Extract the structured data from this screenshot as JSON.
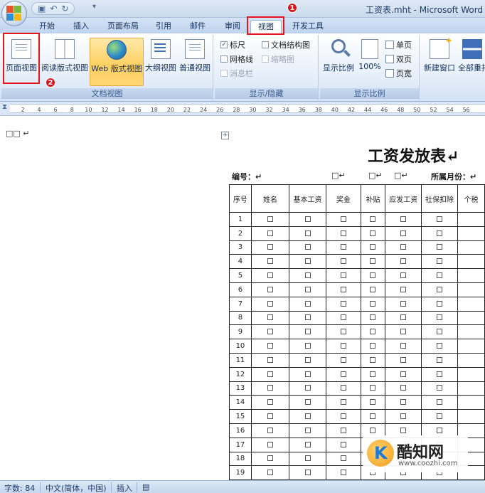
{
  "window": {
    "title": "工资表.mht - Microsoft Word"
  },
  "tabs": [
    "开始",
    "插入",
    "页面布局",
    "引用",
    "邮件",
    "审阅",
    "视图",
    "开发工具"
  ],
  "active_tab": "视图",
  "annotations": {
    "badge1": "1",
    "badge2": "2"
  },
  "ribbon": {
    "doc_views": {
      "label": "文档视图",
      "buttons": [
        "页面视图",
        "阅读版式视图",
        "Web 版式视图",
        "大纲视图",
        "普通视图"
      ],
      "selected": "Web 版式视图"
    },
    "show_hide": {
      "label": "显示/隐藏",
      "ruler": {
        "label": "标尺",
        "checked": true
      },
      "doc_map": {
        "label": "文档结构图",
        "checked": false
      },
      "gridlines": {
        "label": "网格线",
        "checked": false
      },
      "thumbnails": {
        "label": "缩略图",
        "checked": false,
        "disabled": true
      },
      "message_bar": {
        "label": "消息栏",
        "checked": false,
        "disabled": true
      }
    },
    "zoom": {
      "label": "显示比例",
      "zoom_button": "显示比例",
      "hundred_button": "100%",
      "one_page": "单页",
      "two_pages": "双页",
      "page_width": "页宽"
    },
    "window": {
      "new_window": "新建窗口",
      "arrange_all": "全部重排"
    }
  },
  "ruler": {
    "ticks": [
      "2",
      "4",
      "6",
      "8",
      "10",
      "12",
      "14",
      "16",
      "18",
      "20",
      "22",
      "24",
      "26",
      "28",
      "30",
      "32",
      "34",
      "36",
      "38",
      "40",
      "42",
      "44",
      "46",
      "48",
      "50",
      "52",
      "54",
      "56"
    ]
  },
  "document": {
    "left_marks": "□□ ↵",
    "title": "工资发放表↵",
    "meta": {
      "number_label": "编号：↵",
      "box1": "□↵",
      "box2": "□↵",
      "box3": "□↵",
      "month_label": "所属月份：↵"
    },
    "table": {
      "headers": [
        "序号",
        "姓名",
        "基本工资",
        "奖金",
        "补贴",
        "应发工资",
        "社保扣除",
        "个税"
      ],
      "rows": [
        "1",
        "2",
        "3",
        "4",
        "5",
        "6",
        "7",
        "8",
        "9",
        "10",
        "11",
        "12",
        "13",
        "14",
        "15",
        "16",
        "17",
        "18",
        "19"
      ]
    }
  },
  "watermark": {
    "name": "酷知网",
    "url": "www.coozhi.com"
  },
  "status": {
    "word_count": "字数: 84",
    "language": "中文(简体，中国)",
    "mode": "插入"
  }
}
